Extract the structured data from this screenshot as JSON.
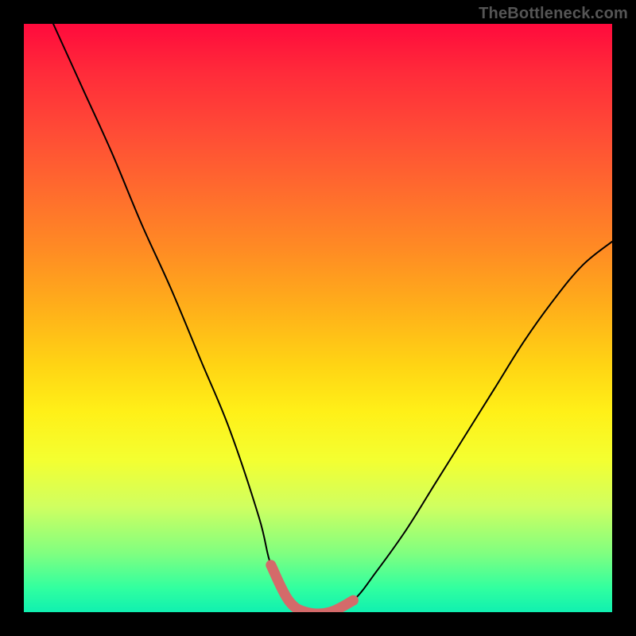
{
  "watermark": "TheBottleneck.com",
  "chart_data": {
    "type": "line",
    "title": "",
    "xlabel": "",
    "ylabel": "",
    "xlim": [
      0,
      100
    ],
    "ylim": [
      0,
      100
    ],
    "series": [
      {
        "name": "bottleneck-curve",
        "color": "#000000",
        "x": [
          5,
          10,
          15,
          20,
          25,
          30,
          35,
          40,
          42,
          45,
          48,
          52,
          56,
          60,
          65,
          70,
          75,
          80,
          85,
          90,
          95,
          100
        ],
        "y": [
          100,
          89,
          78,
          66,
          55,
          43,
          31,
          16,
          8,
          2,
          0,
          0,
          2,
          7,
          14,
          22,
          30,
          38,
          46,
          53,
          59,
          63
        ]
      }
    ],
    "highlight": {
      "name": "near-zero-bottleneck",
      "color": "#d46a6a",
      "x": [
        42,
        45,
        48,
        52,
        56
      ],
      "y": [
        8,
        2,
        0,
        0,
        2
      ]
    },
    "background_gradient": {
      "direction": "vertical",
      "stops": [
        {
          "pos": 0.0,
          "color": "#ff0a3c"
        },
        {
          "pos": 0.18,
          "color": "#ff4a36"
        },
        {
          "pos": 0.38,
          "color": "#ff8a24"
        },
        {
          "pos": 0.58,
          "color": "#ffd414"
        },
        {
          "pos": 0.74,
          "color": "#f4ff30"
        },
        {
          "pos": 0.9,
          "color": "#80ff80"
        },
        {
          "pos": 1.0,
          "color": "#10f0b0"
        }
      ]
    }
  }
}
